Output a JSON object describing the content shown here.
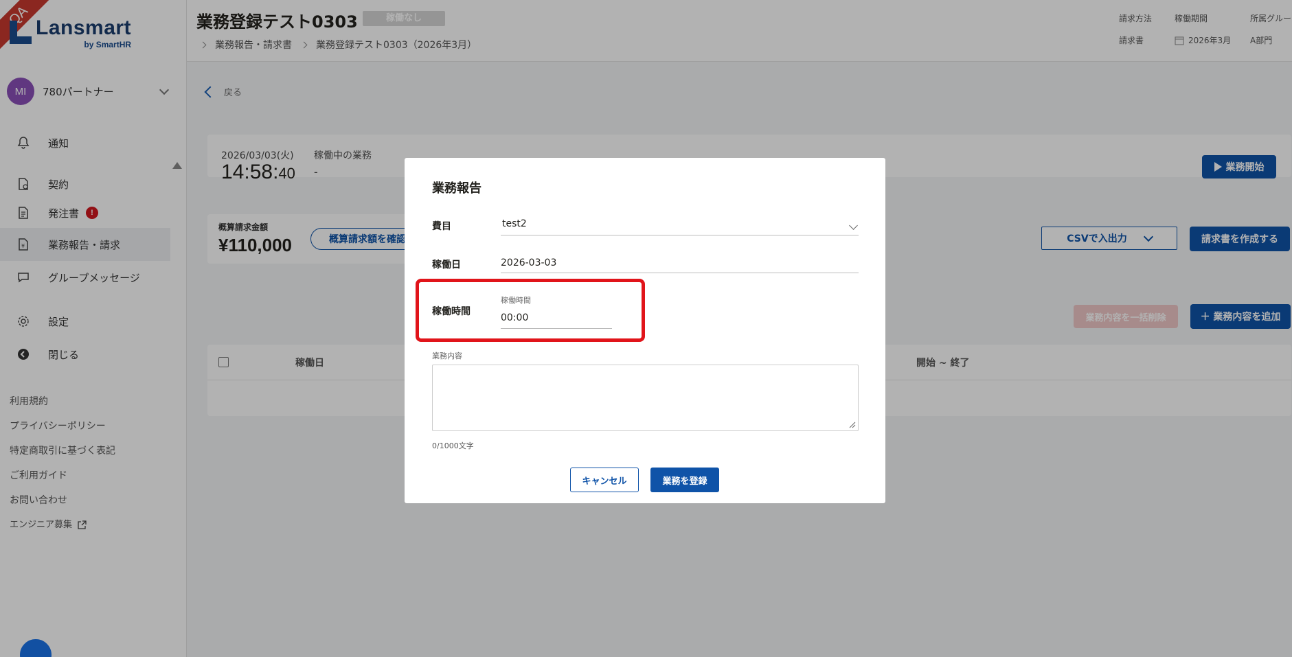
{
  "app": {
    "ribbon": "QA",
    "logo_name": "Lansmart",
    "logo_sub": "by SmartHR"
  },
  "account": {
    "initials": "MI",
    "name": "780パートナー"
  },
  "sidebar": {
    "items": [
      {
        "label": "通知",
        "icon": "bell-icon"
      },
      {
        "label": "契約",
        "icon": "contract-icon"
      },
      {
        "label": "発注書",
        "icon": "document-icon",
        "badge": "!"
      },
      {
        "label": "業務報告・請求",
        "icon": "invoice-icon",
        "active": true
      },
      {
        "label": "グループメッセージ",
        "icon": "chat-icon"
      },
      {
        "label": "設定",
        "icon": "gear-icon"
      },
      {
        "label": "閉じる",
        "icon": "collapse-icon"
      }
    ],
    "footer_links": [
      "利用規約",
      "プライバシーポリシー",
      "特定商取引に基づく表記",
      "ご利用ガイド",
      "お問い合わせ",
      "エンジニア募集"
    ]
  },
  "header": {
    "title": "業務登録テスト0303",
    "status_tag": "稼働なし",
    "breadcrumb": [
      "業務報告・請求書",
      "業務登録テスト0303（2026年3月）"
    ],
    "meta": [
      {
        "label": "請求方法",
        "value": "請求書"
      },
      {
        "label": "稼働期間",
        "value": "2026年3月"
      },
      {
        "label": "所属グルー",
        "value": "A部門"
      }
    ]
  },
  "main": {
    "back_label": "戻る",
    "clock": {
      "date": "2026/03/03(火)",
      "time_hm": "14:58:",
      "time_s": "40",
      "running_label": "稼働中の業務",
      "running_value": "-",
      "start_button": "業務開始"
    },
    "amount": {
      "label": "概算請求金額",
      "value": "¥110,000",
      "confirm_button": "概算請求額を確認す"
    },
    "csv_button": "CSVで入出力",
    "invoice_button": "請求書を作成する",
    "bulk_delete_button": "業務内容を一括削除",
    "add_button": "＋ 業務内容を追加",
    "table": {
      "columns": [
        "稼働日",
        "開始 ~ 終了"
      ]
    }
  },
  "modal": {
    "title": "業務報告",
    "fields": {
      "expense_label": "費目",
      "expense_value": "test2",
      "workday_label": "稼働日",
      "workday_value": "2026-03-03",
      "worktime_label": "稼働時間",
      "worktime_sublabel": "稼働時間",
      "worktime_value": "00:00",
      "content_label": "業務内容",
      "counter": "0/1000文字"
    },
    "cancel_button": "キャンセル",
    "submit_button": "業務を登録"
  },
  "colors": {
    "primary": "#0f53a8",
    "highlight": "#e1141a",
    "badge": "#d2171f"
  }
}
